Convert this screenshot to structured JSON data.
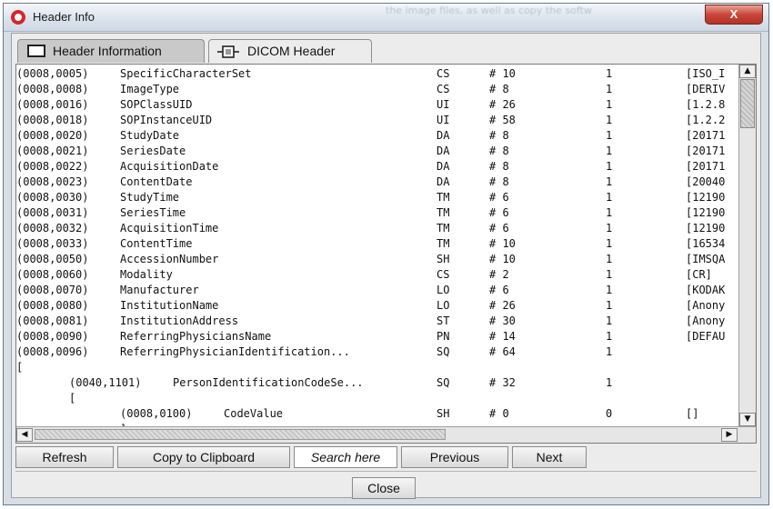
{
  "window": {
    "title": "Header Info",
    "close_glyph": "X",
    "background_text": "the image files, as well as copy the softw"
  },
  "tabs": [
    {
      "label": "Header Information",
      "icon": "window-icon",
      "selected": true
    },
    {
      "label": "DICOM Header",
      "icon": "connector-icon",
      "selected": false
    }
  ],
  "table": {
    "rows": [
      {
        "tag": "(0008,0005)",
        "name": "SpecificCharacterSet",
        "vr": "CS",
        "len": "# 10",
        "vm": "1",
        "value": "[ISO_I"
      },
      {
        "tag": "(0008,0008)",
        "name": "ImageType",
        "vr": "CS",
        "len": "# 8",
        "vm": "1",
        "value": "[DERIV"
      },
      {
        "tag": "(0008,0016)",
        "name": "SOPClassUID",
        "vr": "UI",
        "len": "# 26",
        "vm": "1",
        "value": "[1.2.8"
      },
      {
        "tag": "(0008,0018)",
        "name": "SOPInstanceUID",
        "vr": "UI",
        "len": "# 58",
        "vm": "1",
        "value": "[1.2.2"
      },
      {
        "tag": "(0008,0020)",
        "name": "StudyDate",
        "vr": "DA",
        "len": "# 8",
        "vm": "1",
        "value": "[20171"
      },
      {
        "tag": "(0008,0021)",
        "name": "SeriesDate",
        "vr": "DA",
        "len": "# 8",
        "vm": "1",
        "value": "[20171"
      },
      {
        "tag": "(0008,0022)",
        "name": "AcquisitionDate",
        "vr": "DA",
        "len": "# 8",
        "vm": "1",
        "value": "[20171"
      },
      {
        "tag": "(0008,0023)",
        "name": "ContentDate",
        "vr": "DA",
        "len": "# 8",
        "vm": "1",
        "value": "[20040"
      },
      {
        "tag": "(0008,0030)",
        "name": "StudyTime",
        "vr": "TM",
        "len": "# 6",
        "vm": "1",
        "value": "[12190"
      },
      {
        "tag": "(0008,0031)",
        "name": "SeriesTime",
        "vr": "TM",
        "len": "# 6",
        "vm": "1",
        "value": "[12190"
      },
      {
        "tag": "(0008,0032)",
        "name": "AcquisitionTime",
        "vr": "TM",
        "len": "# 6",
        "vm": "1",
        "value": "[12190"
      },
      {
        "tag": "(0008,0033)",
        "name": "ContentTime",
        "vr": "TM",
        "len": "# 10",
        "vm": "1",
        "value": "[16534"
      },
      {
        "tag": "(0008,0050)",
        "name": "AccessionNumber",
        "vr": "SH",
        "len": "# 10",
        "vm": "1",
        "value": "[IMSQA"
      },
      {
        "tag": "(0008,0060)",
        "name": "Modality",
        "vr": "CS",
        "len": "# 2",
        "vm": "1",
        "value": "[CR]"
      },
      {
        "tag": "(0008,0070)",
        "name": "Manufacturer",
        "vr": "LO",
        "len": "# 6",
        "vm": "1",
        "value": "[KODAK"
      },
      {
        "tag": "(0008,0080)",
        "name": "InstitutionName",
        "vr": "LO",
        "len": "# 26",
        "vm": "1",
        "value": "[Anony"
      },
      {
        "tag": "(0008,0081)",
        "name": "InstitutionAddress",
        "vr": "ST",
        "len": "# 30",
        "vm": "1",
        "value": "[Anony"
      },
      {
        "tag": "(0008,0090)",
        "name": "ReferringPhysiciansName",
        "vr": "PN",
        "len": "# 14",
        "vm": "1",
        "value": "[DEFAU"
      },
      {
        "tag": "(0008,0096)",
        "name": "ReferringPhysicianIdentification...",
        "vr": "SQ",
        "len": "# 64",
        "vm": "1",
        "value": ""
      },
      {
        "tag": "[",
        "name": "",
        "vr": "",
        "len": "",
        "vm": "",
        "value": "",
        "indent": 0
      },
      {
        "tag": "(0040,1101)",
        "name": "PersonIdentificationCodeSe...",
        "vr": "SQ",
        "len": "# 32",
        "vm": "1",
        "value": "",
        "indent": 1
      },
      {
        "tag": "[",
        "name": "",
        "vr": "",
        "len": "",
        "vm": "",
        "value": "",
        "indent": 1
      },
      {
        "tag": "(0008,0100)",
        "name": "CodeValue",
        "vr": "SH",
        "len": "# 0",
        "vm": "0",
        "value": "[]",
        "indent": 2
      },
      {
        "tag": "]",
        "name": "",
        "vr": "",
        "len": "",
        "vm": "",
        "value": "",
        "indent": 2
      }
    ]
  },
  "scrollbars": {
    "vertical": {
      "up_glyph": "▲",
      "down_glyph": "▼",
      "position_fraction": 0.0
    },
    "horizontal": {
      "left_glyph": "◀",
      "right_glyph": "▶",
      "position_fraction": 0.0
    }
  },
  "buttons": {
    "refresh": "Refresh",
    "copy": "Copy to Clipboard",
    "previous": "Previous",
    "next": "Next",
    "close": "Close"
  },
  "search": {
    "value": "Search here"
  }
}
